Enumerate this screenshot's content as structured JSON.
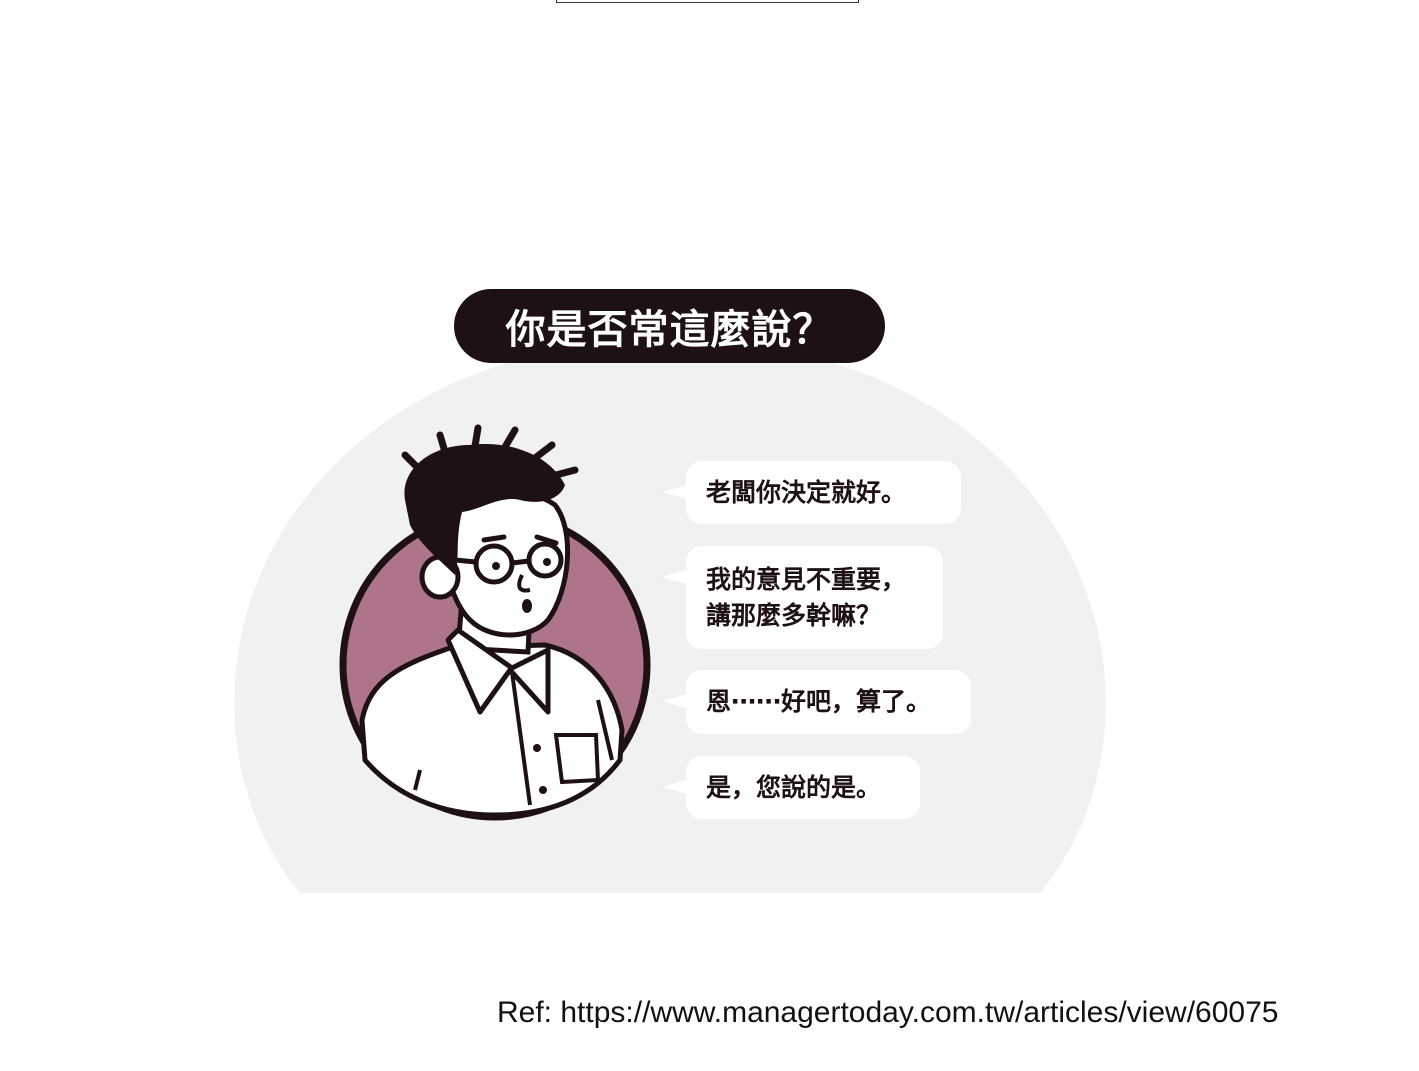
{
  "title": "你是否常這麼說？",
  "bubbles": {
    "b1": {
      "line1": "老闆你決定就好。"
    },
    "b2": {
      "line1": "我的意見不重要，",
      "line2": "講那麼多幹嘛？"
    },
    "b3": {
      "line1": "恩⋯⋯好吧，算了。"
    },
    "b4": {
      "line1": "是，您說的是。"
    }
  },
  "reference": "Ref: https://www.managertoday.com.tw/articles/view/60075",
  "colors": {
    "background_shape": "#f1f1f1",
    "title_pill": "#1d1113",
    "avatar_circle": "#ae748b",
    "outline": "#1d1113",
    "bubble": "#ffffff"
  }
}
